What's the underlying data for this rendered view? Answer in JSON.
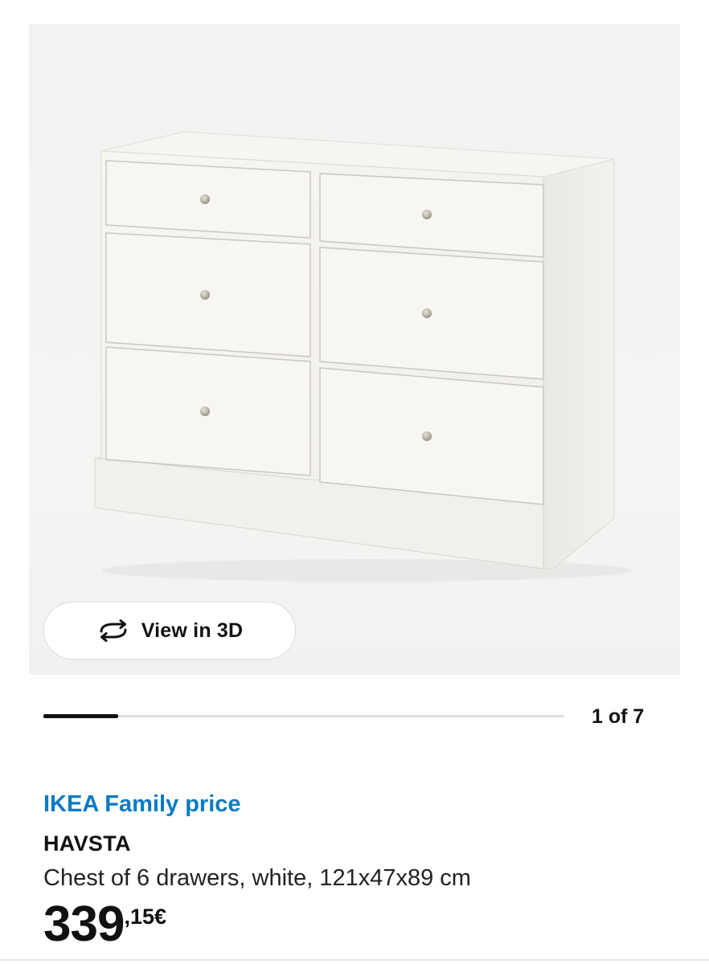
{
  "product_image": {
    "alt": "",
    "view_3d_button": {
      "label": "View in 3D",
      "icon": "rotate-3d-icon"
    }
  },
  "carousel": {
    "counter": "1 of 7",
    "current": 1,
    "total": 7
  },
  "product": {
    "price_label": "IKEA Family price",
    "name": "HAVSTA",
    "description": "Chest of 6 drawers, white, 121x47x89 cm",
    "price": {
      "integer": "339",
      "decimal": ",15",
      "currency": "€"
    }
  },
  "colors": {
    "family_price": "#0a7bc2",
    "text": "#111111",
    "progress_fill": "#111111",
    "progress_track": "#dfdfdf"
  }
}
